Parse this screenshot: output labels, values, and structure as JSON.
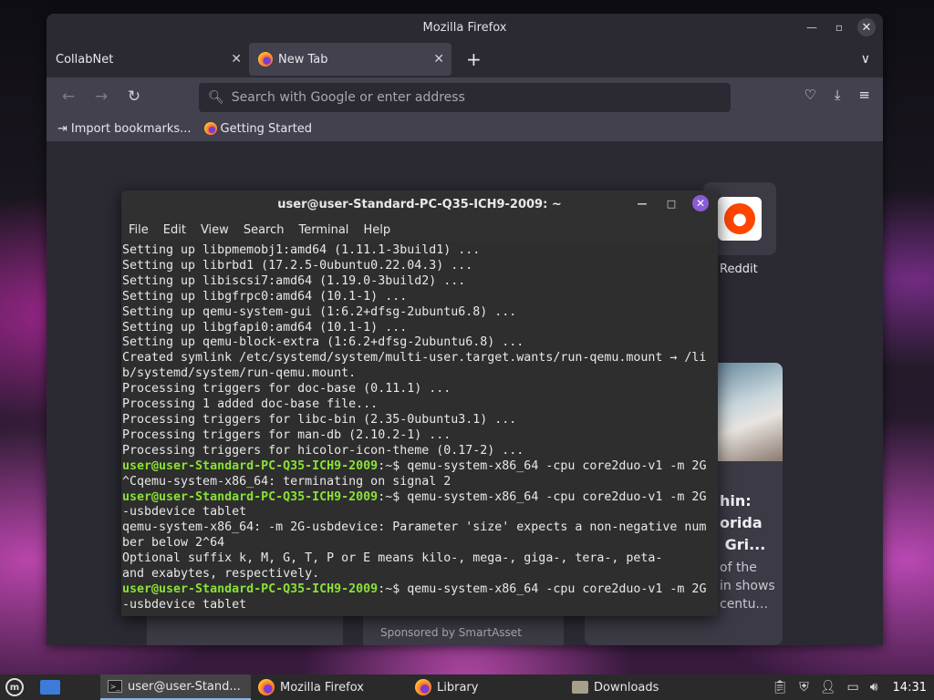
{
  "firefox": {
    "window_title": "Mozilla Firefox",
    "tabs": [
      {
        "label": "CollabNet",
        "active": false
      },
      {
        "label": "New Tab",
        "active": true
      }
    ],
    "urlbar_placeholder": "Search with Google or enter address",
    "bookmarks": [
      {
        "label": "Import bookmarks..."
      },
      {
        "label": "Getting Started"
      }
    ],
    "shortcuts": [
      {
        "label": "Reddit"
      }
    ],
    "story": {
      "title": "hin:\norida\n Gri...",
      "excerpt": "of the\nin shows\ncentu..."
    },
    "sponsored": "Sponsored by SmartAsset"
  },
  "terminal": {
    "title": "user@user-Standard-PC-Q35-ICH9-2009: ~",
    "menu": [
      "File",
      "Edit",
      "View",
      "Search",
      "Terminal",
      "Help"
    ],
    "prompt": "user@user-Standard-PC-Q35-ICH9-2009",
    "lines": [
      {
        "text": "Setting up libpmemobj1:amd64 (1.11.1-3build1) ..."
      },
      {
        "text": "Setting up librbd1 (17.2.5-0ubuntu0.22.04.3) ..."
      },
      {
        "text": "Setting up libiscsi7:amd64 (1.19.0-3build2) ..."
      },
      {
        "text": "Setting up libgfrpc0:amd64 (10.1-1) ..."
      },
      {
        "text": "Setting up qemu-system-gui (1:6.2+dfsg-2ubuntu6.8) ..."
      },
      {
        "text": "Setting up libgfapi0:amd64 (10.1-1) ..."
      },
      {
        "text": "Setting up qemu-block-extra (1:6.2+dfsg-2ubuntu6.8) ..."
      },
      {
        "text": "Created symlink /etc/systemd/system/multi-user.target.wants/run-qemu.mount → /li"
      },
      {
        "text": "b/systemd/system/run-qemu.mount."
      },
      {
        "text": "Processing triggers for doc-base (0.11.1) ..."
      },
      {
        "text": "Processing 1 added doc-base file..."
      },
      {
        "text": "Processing triggers for libc-bin (2.35-0ubuntu3.1) ..."
      },
      {
        "text": "Processing triggers for man-db (2.10.2-1) ..."
      },
      {
        "text": "Processing triggers for hicolor-icon-theme (0.17-2) ..."
      },
      {
        "prompt": true,
        "text": ":~$ qemu-system-x86_64 -cpu core2duo-v1 -m 2G"
      },
      {
        "text": "^Cqemu-system-x86_64: terminating on signal 2"
      },
      {
        "prompt": true,
        "text": ":~$ qemu-system-x86_64 -cpu core2duo-v1 -m 2G"
      },
      {
        "text": "-usbdevice tablet"
      },
      {
        "text": "qemu-system-x86_64: -m 2G-usbdevice: Parameter 'size' expects a non-negative num"
      },
      {
        "text": "ber below 2^64"
      },
      {
        "text": "Optional suffix k, M, G, T, P or E means kilo-, mega-, giga-, tera-, peta-"
      },
      {
        "text": "and exabytes, respectively."
      },
      {
        "prompt": true,
        "text": ":~$ qemu-system-x86_64 -cpu core2duo-v1 -m 2G"
      },
      {
        "text": "-usbdevice tablet"
      }
    ]
  },
  "taskbar": {
    "tasks": [
      {
        "label": "user@user-Stand...",
        "icon": "terminal-icon",
        "active": true
      },
      {
        "label": "Mozilla Firefox",
        "icon": "firefox-icon",
        "active": false
      },
      {
        "label": "Library",
        "icon": "firefox-icon",
        "active": false
      },
      {
        "label": "Downloads",
        "icon": "folder-icon",
        "active": false
      }
    ],
    "clock": "14:31"
  }
}
